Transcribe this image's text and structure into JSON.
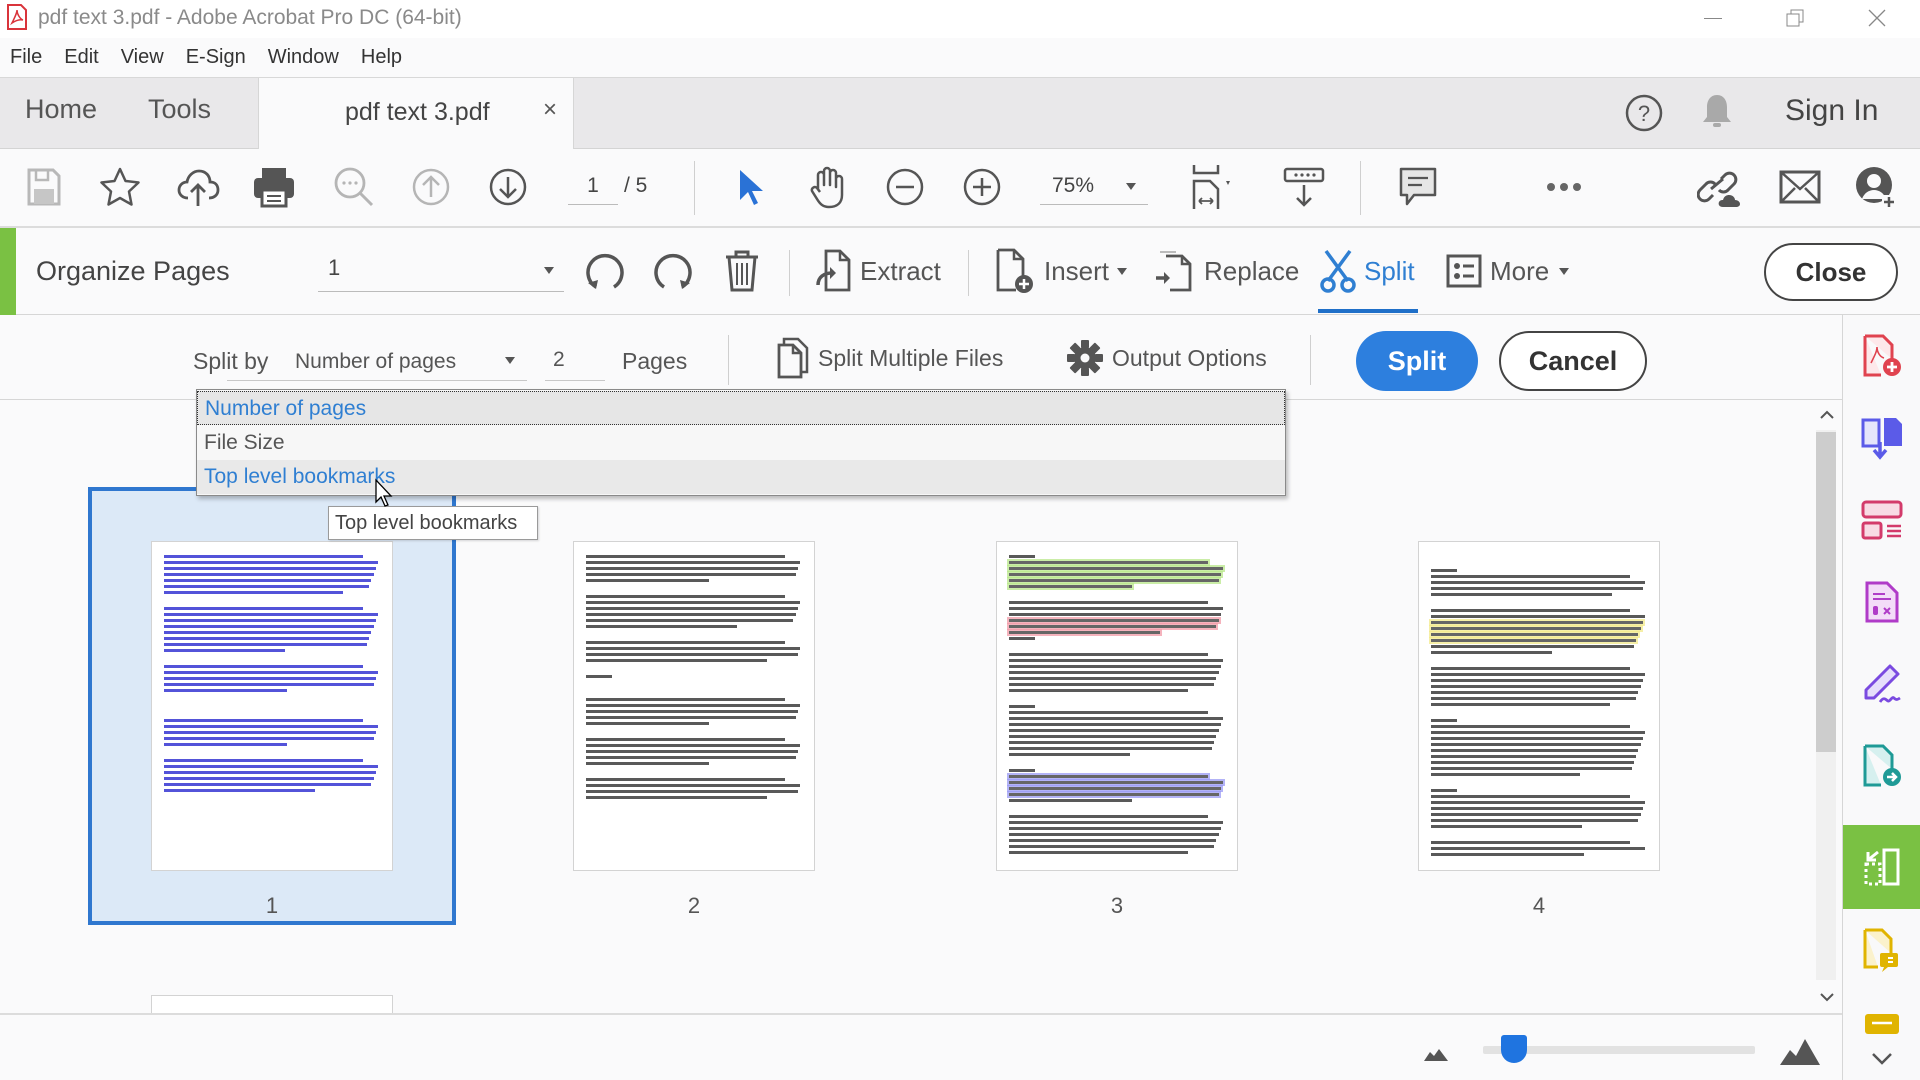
{
  "window": {
    "title": "pdf text 3.pdf - Adobe Acrobat Pro DC (64-bit)",
    "minimize_label": "—",
    "restore_label": "❐",
    "close_label": "✕"
  },
  "menu": [
    "File",
    "Edit",
    "View",
    "E-Sign",
    "Window",
    "Help"
  ],
  "tabs": {
    "home": "Home",
    "tools": "Tools",
    "document": "pdf text 3.pdf",
    "document_close": "×",
    "sign_in": "Sign In"
  },
  "toolbar": {
    "current_page": "1",
    "page_total": "/ 5",
    "zoom": "75%"
  },
  "organize": {
    "title": "Organize Pages",
    "page_range": "1",
    "extract_label": "Extract",
    "insert_label": "Insert",
    "replace_label": "Replace",
    "split_label": "Split",
    "more_label": "More",
    "close_label": "Close"
  },
  "split_bar": {
    "split_by_label": "Split by",
    "split_by_value": "Number of pages",
    "pages_count": "2",
    "pages_label": "Pages",
    "split_multiple_label": "Split Multiple Files",
    "output_options_label": "Output Options",
    "split_button": "Split",
    "cancel_button": "Cancel"
  },
  "dropdown": {
    "options": [
      {
        "label": "Number of pages",
        "state": "selected"
      },
      {
        "label": "File Size",
        "state": "normal"
      },
      {
        "label": "Top level bookmarks",
        "state": "hovered"
      }
    ],
    "tooltip": "Top level bookmarks"
  },
  "thumbnails": [
    {
      "page": "1",
      "selected": true,
      "text_color": "#1a1acc"
    },
    {
      "page": "2",
      "selected": false,
      "text_color": "#222222"
    },
    {
      "page": "3",
      "selected": false,
      "text_color": "#222222",
      "highlights": [
        "#b9e88a",
        "#f29aa8",
        "#9a9af5",
        "#f4df7a"
      ]
    },
    {
      "page": "4",
      "selected": false,
      "text_color": "#222222",
      "highlights": [
        "#f4ea8a"
      ]
    }
  ],
  "thumbnail_size_slider": {
    "value_percent": 6
  },
  "right_panel_tools": [
    {
      "name": "create-pdf",
      "color": "#e0434f"
    },
    {
      "name": "combine-files",
      "color": "#5b5be8"
    },
    {
      "name": "organize-layout",
      "color": "#d33b6b"
    },
    {
      "name": "edit-pdf",
      "color": "#b03cc8"
    },
    {
      "name": "fill-sign",
      "color": "#7a4ae0"
    },
    {
      "name": "export-pdf",
      "color": "#1f9a96"
    },
    {
      "name": "organize-pages",
      "color": "#7ac143",
      "active": true
    },
    {
      "name": "comment",
      "color": "#e0b400"
    },
    {
      "name": "stamp",
      "color": "#e0b400"
    }
  ],
  "colors": {
    "accent_blue": "#2d7fde",
    "organize_green": "#7ac143"
  }
}
